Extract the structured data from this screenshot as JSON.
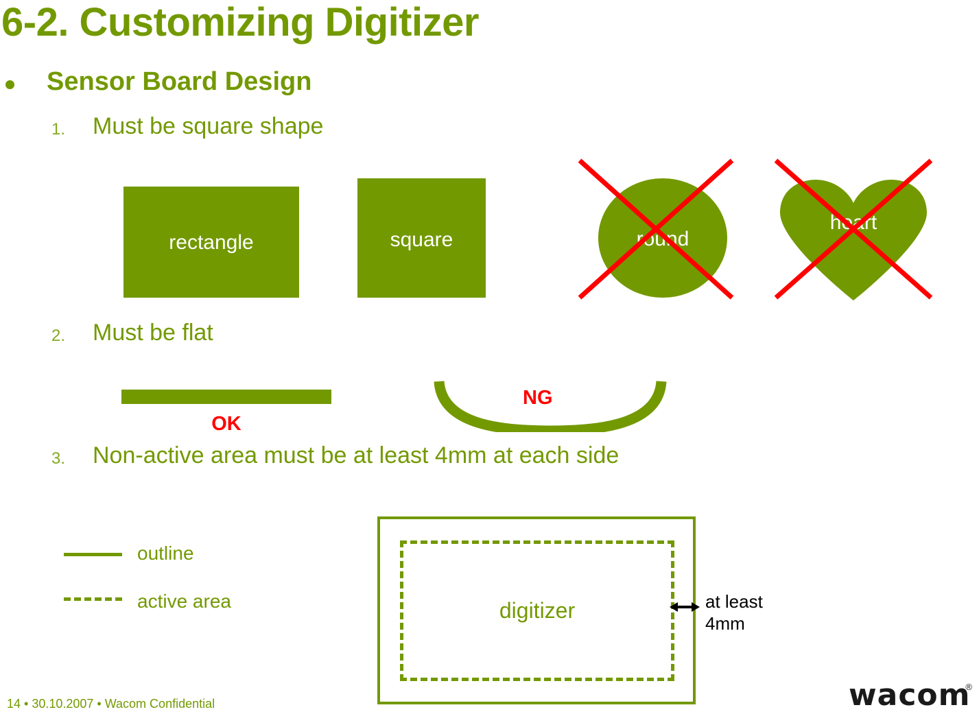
{
  "slide": {
    "title": "6-2. Customizing Digitizer",
    "bullet": "Sensor Board Design",
    "items": [
      {
        "number": "1.",
        "text": "Must be square shape"
      },
      {
        "number": "2.",
        "text": "Must be flat"
      },
      {
        "number": "3.",
        "text": "Non-active area must be at least 4mm at each side"
      }
    ],
    "shapes": [
      {
        "name": "rectangle",
        "label": "rectangle",
        "allowed": true
      },
      {
        "name": "square",
        "label": "square",
        "allowed": true
      },
      {
        "name": "round",
        "label": "round",
        "allowed": false
      },
      {
        "name": "heart",
        "label": "heart",
        "allowed": false
      }
    ],
    "flatness": {
      "ok_label": "OK",
      "ng_label": "NG"
    },
    "legend": [
      {
        "style": "solid",
        "label": "outline"
      },
      {
        "style": "dashed",
        "label": "active area"
      }
    ],
    "diagram": {
      "board_label": "digitizer",
      "margin_label_line1": "at least",
      "margin_label_line2": "4mm"
    },
    "footer": {
      "text": "14 • 30.10.2007 • Wacom Confidential",
      "logo_wordmark": "wacom",
      "logo_registered": "®"
    },
    "colors": {
      "brand_green": "#739900",
      "reject_red": "#ff0000",
      "number_green": "#85a922",
      "label_white": "#ffffff",
      "annotation_black": "#000000"
    }
  }
}
